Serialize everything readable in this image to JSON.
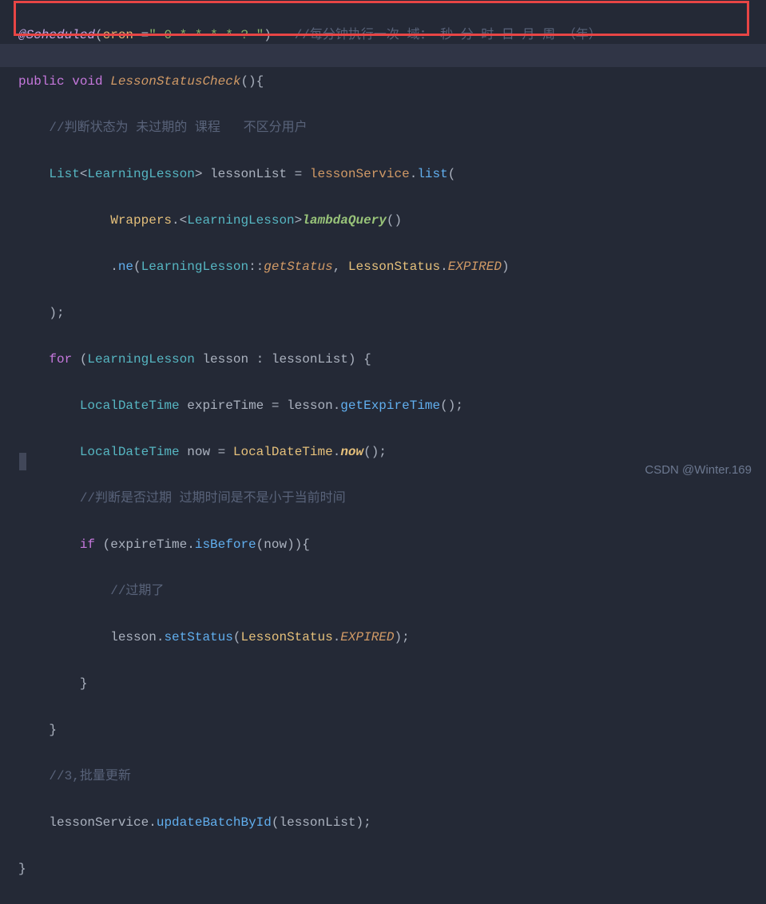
{
  "lines": {
    "l1_annotation": "@Scheduled",
    "l1_paren_open": "(",
    "l1_param": "cron ",
    "l1_equals": "=",
    "l1_string": "\" 0 * * * * ? \"",
    "l1_paren_close": ")",
    "l1_comment": "   //每分钟执行一次 域： 秒 分 时 日 月 周 （年）",
    "l2_keyword1": "public",
    "l2_keyword2": " void ",
    "l2_method": "LessonStatusCheck",
    "l2_parens": "()",
    "l2_brace": "{",
    "l3_comment": "    //判断状态为 未过期的 课程   不区分用户",
    "l4_indent": "    ",
    "l4_type1": "List",
    "l4_angle1": "<",
    "l4_type2": "LearningLesson",
    "l4_angle2": "> ",
    "l4_var": "lessonList",
    "l4_eq": " = ",
    "l4_obj": "lessonService",
    "l4_dot": ".",
    "l4_method": "list",
    "l4_paren": "(",
    "l5_indent": "            ",
    "l5_class": "Wrappers",
    "l5_dot": ".<",
    "l5_type": "LearningLesson",
    "l5_angle": ">",
    "l5_method": "lambdaQuery",
    "l5_parens": "()",
    "l6_indent": "            ",
    "l6_dot": ".",
    "l6_method": "ne",
    "l6_paren1": "(",
    "l6_type": "LearningLesson",
    "l6_ref": "::",
    "l6_getter": "getStatus",
    "l6_comma": ", ",
    "l6_class": "LessonStatus",
    "l6_dot2": ".",
    "l6_const": "EXPIRED",
    "l6_paren2": ")",
    "l7": "    );",
    "l8_indent": "    ",
    "l8_for": "for",
    "l8_paren1": " (",
    "l8_type": "LearningLesson",
    "l8_sp": " ",
    "l8_var": "lesson",
    "l8_colon": " : ",
    "l8_list": "lessonList",
    "l8_paren2": ") {",
    "l9_indent": "        ",
    "l9_type": "LocalDateTime",
    "l9_sp": " ",
    "l9_var": "expireTime",
    "l9_eq": " = ",
    "l9_obj": "lesson",
    "l9_dot": ".",
    "l9_method": "getExpireTime",
    "l9_parens": "();",
    "l10_indent": "        ",
    "l10_type": "LocalDateTime",
    "l10_sp": " ",
    "l10_var": "now",
    "l10_eq": " = ",
    "l10_class": "LocalDateTime",
    "l10_dot": ".",
    "l10_method": "now",
    "l10_parens": "();",
    "l11_comment": "        //判断是否过期 过期时间是不是小于当前时间",
    "l12_indent": "        ",
    "l12_if": "if",
    "l12_paren1": " (",
    "l12_var": "expireTime",
    "l12_dot": ".",
    "l12_method": "isBefore",
    "l12_paren2": "(",
    "l12_arg": "now",
    "l12_paren3": ")){",
    "l13_comment": "            //过期了",
    "l14_indent": "            ",
    "l14_obj": "lesson",
    "l14_dot": ".",
    "l14_method": "setStatus",
    "l14_paren1": "(",
    "l14_class": "LessonStatus",
    "l14_dot2": ".",
    "l14_const": "EXPIRED",
    "l14_paren2": ");",
    "l15": "        }",
    "l16": "    }",
    "l17_comment": "    //3,批量更新",
    "l18_indent": "    ",
    "l18_obj": "lessonService",
    "l18_dot": ".",
    "l18_method": "updateBatchById",
    "l18_paren1": "(",
    "l18_arg": "lessonList",
    "l18_paren2": ");",
    "l19": "}"
  },
  "watermark": "CSDN @Winter.169"
}
